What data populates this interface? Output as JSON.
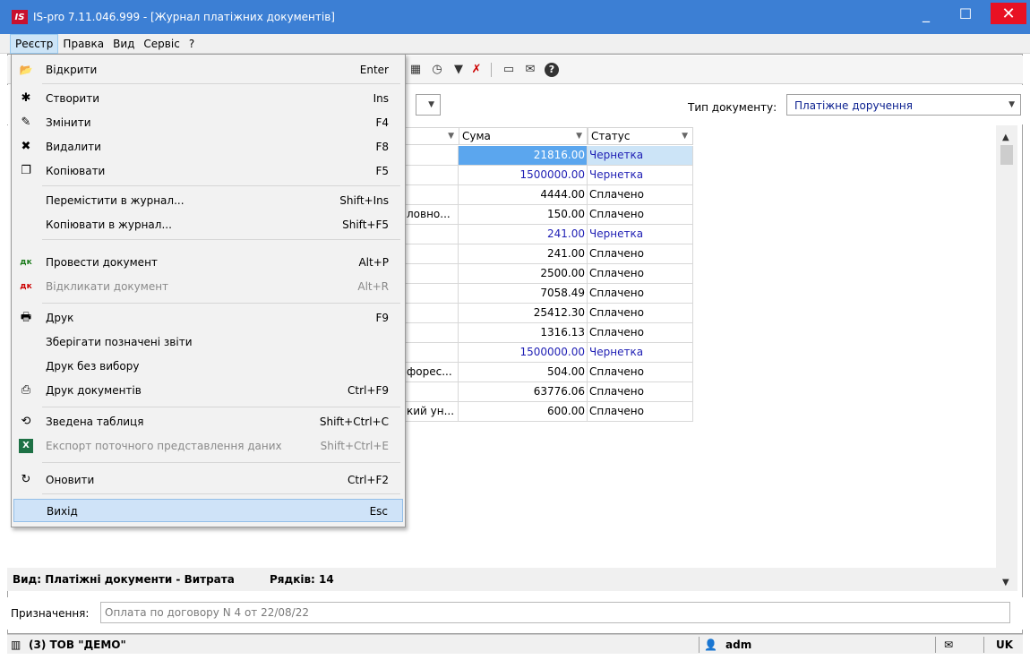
{
  "window": {
    "app_logo": "IS",
    "title": "IS-pro 7.11.046.999 - [Журнал платіжних документів]",
    "min_glyph": "_",
    "max_glyph": "☐",
    "close_glyph": "✕"
  },
  "menubar": [
    "Реєстр",
    "Правка",
    "Вид",
    "Сервіс",
    "?"
  ],
  "filter": {
    "doctype_label": "Тип документу:",
    "doctype_value": "Платіжне доручення"
  },
  "grid": {
    "columns": [
      {
        "label": "Сума"
      },
      {
        "label": "Статус"
      }
    ],
    "rows": [
      {
        "fragment": "",
        "sum": "21816.00",
        "status": "Чернетка",
        "draft": true
      },
      {
        "fragment": "",
        "sum": "1500000.00",
        "status": "Чернетка",
        "draft": true
      },
      {
        "fragment": "",
        "sum": "4444.00",
        "status": "Сплачено",
        "draft": false
      },
      {
        "fragment": "ловно...",
        "sum": "150.00",
        "status": "Сплачено",
        "draft": false
      },
      {
        "fragment": "",
        "sum": "241.00",
        "status": "Чернетка",
        "draft": true
      },
      {
        "fragment": "",
        "sum": "241.00",
        "status": "Сплачено",
        "draft": false
      },
      {
        "fragment": "",
        "sum": "2500.00",
        "status": "Сплачено",
        "draft": false
      },
      {
        "fragment": "",
        "sum": "7058.49",
        "status": "Сплачено",
        "draft": false
      },
      {
        "fragment": "",
        "sum": "25412.30",
        "status": "Сплачено",
        "draft": false
      },
      {
        "fragment": "",
        "sum": "1316.13",
        "status": "Сплачено",
        "draft": false
      },
      {
        "fragment": "",
        "sum": "1500000.00",
        "status": "Чернетка",
        "draft": true
      },
      {
        "fragment": "форес...",
        "sum": "504.00",
        "status": "Сплачено",
        "draft": false
      },
      {
        "fragment": "",
        "sum": "63776.06",
        "status": "Сплачено",
        "draft": false
      },
      {
        "fragment": "кий ун...",
        "sum": "600.00",
        "status": "Сплачено",
        "draft": false
      }
    ]
  },
  "viewbar": {
    "view": "Вид: Платіжні документи - Витрата",
    "rows": "Рядків: 14"
  },
  "purpose": {
    "label": "Призначення:",
    "value": "Оплата по договору N 4 от 22/08/22"
  },
  "statusbar": {
    "company": "(3) ТОВ \"ДЕМО\"",
    "user": "adm",
    "lang": "UK"
  },
  "dropdown": {
    "items": [
      {
        "icon": "open-folder-icon",
        "glyph": "📂",
        "label": "Відкрити",
        "shortcut": "Enter",
        "disabled": false
      },
      {
        "icon": "new-document-icon",
        "glyph": "✱",
        "label": "Створити",
        "shortcut": "Ins",
        "disabled": false
      },
      {
        "icon": "edit-document-icon",
        "glyph": "✎",
        "label": "Змінити",
        "shortcut": "F4",
        "disabled": false
      },
      {
        "icon": "delete-document-icon",
        "glyph": "✖",
        "label": "Видалити",
        "shortcut": "F8",
        "disabled": false
      },
      {
        "icon": "copy-icon",
        "glyph": "❐",
        "label": "Копіювати",
        "shortcut": "F5",
        "disabled": false
      },
      {
        "icon": "",
        "glyph": "",
        "label": "Перемістити в журнал...",
        "shortcut": "Shift+Ins",
        "disabled": false
      },
      {
        "icon": "",
        "glyph": "",
        "label": "Копіювати в журнал...",
        "shortcut": "Shift+F5",
        "disabled": false
      },
      {
        "icon": "post-document-icon",
        "glyph": "дк",
        "label": "Провести документ",
        "shortcut": "Alt+P",
        "disabled": false
      },
      {
        "icon": "recall-document-icon",
        "glyph": "дк",
        "label": "Відкликати документ",
        "shortcut": "Alt+R",
        "disabled": true
      },
      {
        "icon": "printer-icon",
        "glyph": "🖶",
        "label": "Друк",
        "shortcut": "F9",
        "disabled": false
      },
      {
        "icon": "",
        "glyph": "",
        "label": "Зберігати позначені звіти",
        "shortcut": "",
        "disabled": false
      },
      {
        "icon": "",
        "glyph": "",
        "label": "Друк без вибору",
        "shortcut": "",
        "disabled": false
      },
      {
        "icon": "print-documents-icon",
        "glyph": "⎙",
        "label": "Друк документів",
        "shortcut": "Ctrl+F9",
        "disabled": false
      },
      {
        "icon": "pivot-table-icon",
        "glyph": "⟲",
        "label": "Зведена таблиця",
        "shortcut": "Shift+Ctrl+C",
        "disabled": false
      },
      {
        "icon": "excel-export-icon",
        "glyph": "X",
        "label": "Експорт поточного представлення даних",
        "shortcut": "Shift+Ctrl+E",
        "disabled": true
      },
      {
        "icon": "refresh-icon",
        "glyph": "↻",
        "label": "Оновити",
        "shortcut": "Ctrl+F2",
        "disabled": false
      },
      {
        "icon": "",
        "glyph": "",
        "label": "Вихід",
        "shortcut": "Esc",
        "disabled": false,
        "highlighted": true
      }
    ]
  }
}
